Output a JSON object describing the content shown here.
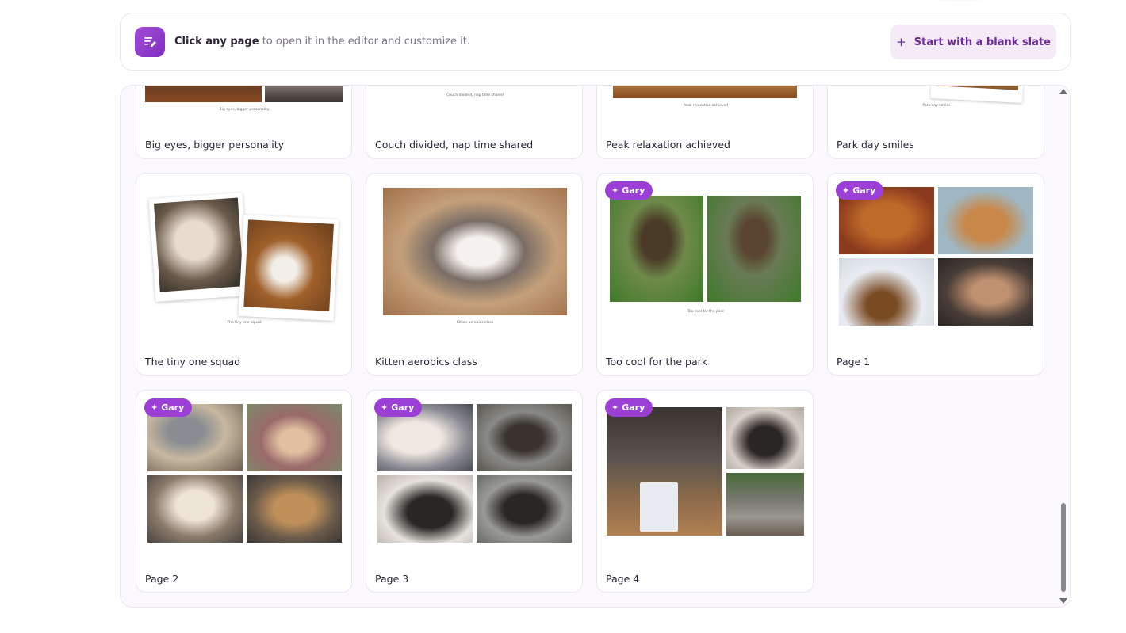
{
  "banner": {
    "bold_text": "Click any page",
    "rest_text": " to open it in the editor and customize it.",
    "blank_button_plus": "+",
    "blank_button_label": "Start with a blank slate"
  },
  "badge_label": "Gary",
  "cards": [
    {
      "label": "Big eyes, bigger personality",
      "caption": "Big eyes, bigger personality"
    },
    {
      "label": "Couch divided, nap time shared",
      "caption": "Couch divided, nap time shared"
    },
    {
      "label": "Peak relaxation achieved",
      "caption": "Peak relaxation achieved"
    },
    {
      "label": "Park day smiles",
      "caption": "Park day smiles"
    },
    {
      "label": "The tiny one squad",
      "caption": "The tiny one squad"
    },
    {
      "label": "Kitten aerobics class",
      "caption": "Kitten aerobics class"
    },
    {
      "label": "Too cool for the park",
      "caption": "Too cool for the park"
    },
    {
      "label": "Page 1"
    },
    {
      "label": "Page 2"
    },
    {
      "label": "Page 3"
    },
    {
      "label": "Page 4"
    }
  ],
  "colors": {
    "accent": "#9b3fd6",
    "button_bg": "#f4eaf8",
    "button_text": "#6d2a9a"
  },
  "icons": {
    "banner_icon": "edit-page-icon",
    "badge_icon": "sparkle-icon"
  }
}
